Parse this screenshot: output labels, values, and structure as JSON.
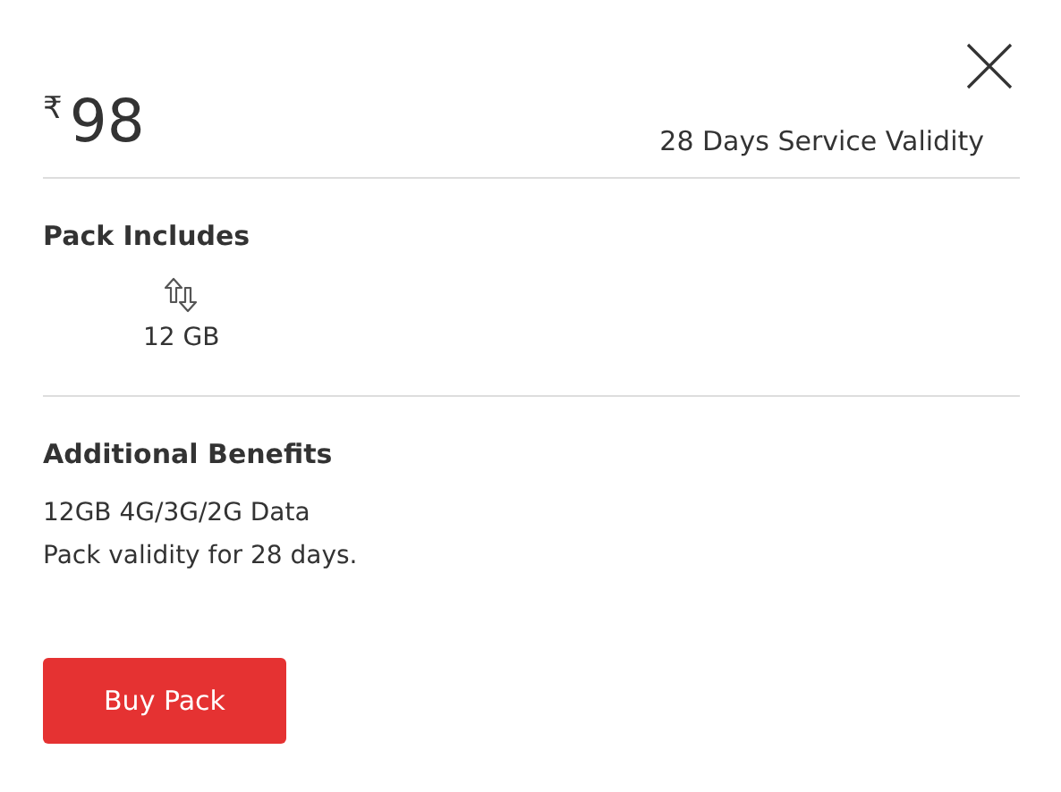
{
  "price": {
    "currency": "₹",
    "amount": "98"
  },
  "validity": "28 Days Service Validity",
  "pack_includes": {
    "title": "Pack Includes",
    "items": [
      {
        "kind": "data",
        "value": "12 GB"
      }
    ]
  },
  "additional_benefits": {
    "title": "Additional Benefits",
    "lines": [
      "12GB 4G/3G/2G Data",
      "Pack validity for 28 days."
    ]
  },
  "buttons": [
    "Buy Pack"
  ]
}
